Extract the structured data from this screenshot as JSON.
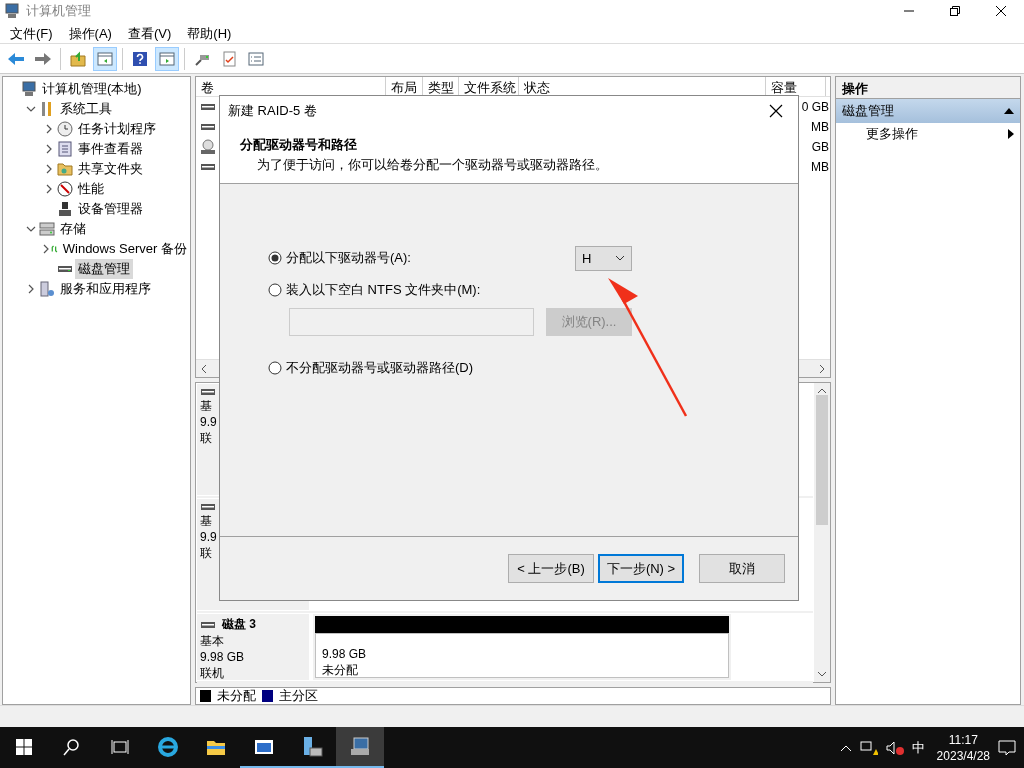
{
  "window": {
    "title": "计算机管理"
  },
  "menu": [
    "文件(F)",
    "操作(A)",
    "查看(V)",
    "帮助(H)"
  ],
  "toolbar": [
    {
      "kind": "back",
      "pressed": false
    },
    {
      "kind": "forward",
      "pressed": false
    },
    {
      "kind": "up",
      "pressed": false
    },
    {
      "kind": "tree-pane",
      "pressed": true
    },
    {
      "kind": "help",
      "pressed": false
    },
    {
      "kind": "action-pane",
      "pressed": true
    },
    {
      "kind": "connect",
      "pressed": false
    },
    {
      "kind": "check",
      "pressed": false
    },
    {
      "kind": "list",
      "pressed": false
    }
  ],
  "tree": [
    {
      "label": "计算机管理(本地)",
      "kind": "computer",
      "selected": false,
      "children": [
        {
          "label": "系统工具",
          "kind": "tools",
          "expanded": true,
          "selected": false,
          "children": [
            {
              "label": "任务计划程序",
              "kind": "clock",
              "expanded": false,
              "selected": false
            },
            {
              "label": "事件查看器",
              "kind": "log",
              "expanded": false,
              "selected": false
            },
            {
              "label": "共享文件夹",
              "kind": "share",
              "expanded": false,
              "selected": false
            },
            {
              "label": "性能",
              "kind": "gauge",
              "expanded": false,
              "selected": false
            },
            {
              "label": "设备管理器",
              "kind": "device",
              "selected": false
            }
          ]
        },
        {
          "label": "存储",
          "kind": "storage",
          "expanded": true,
          "selected": false,
          "children": [
            {
              "label": "Windows Server 备份",
              "kind": "backup",
              "expanded": false,
              "selected": false
            },
            {
              "label": "磁盘管理",
              "kind": "disk",
              "selected": true
            }
          ]
        },
        {
          "label": "服务和应用程序",
          "kind": "services",
          "expanded": false,
          "selected": false
        }
      ]
    }
  ],
  "volume_table": {
    "columns": [
      "卷",
      "布局",
      "类型",
      "文件系统",
      "状态",
      "容量"
    ],
    "rows": [
      {
        "kind": "disk",
        "capacity": "0 GB"
      },
      {
        "kind": "disk",
        "capacity": "MB"
      },
      {
        "kind": "cd",
        "capacity": "GB"
      },
      {
        "kind": "disk",
        "capacity": "MB"
      }
    ]
  },
  "disks": [
    {
      "type": "基",
      "size": "9.9",
      "status": "联"
    },
    {
      "type": "基",
      "size": "9.9",
      "status": "联"
    },
    {
      "name": "磁盘 3",
      "type": "基本",
      "size": "9.98 GB",
      "status": "联机",
      "partition": {
        "size": "9.98 GB",
        "status": "未分配"
      }
    }
  ],
  "legend": [
    {
      "label": "未分配",
      "color": "#000000"
    },
    {
      "label": "主分区",
      "color": "#000080"
    }
  ],
  "actions": {
    "title": "操作",
    "sections": [
      {
        "label": "磁盘管理",
        "expanded": true,
        "items": [
          "更多操作"
        ]
      }
    ]
  },
  "dialog": {
    "title": "新建 RAID-5 卷",
    "heading": "分配驱动器号和路径",
    "description": "为了便于访问，你可以给卷分配一个驱动器号或驱动器路径。",
    "options": [
      {
        "kind": "drive",
        "label": "分配以下驱动器号(A):",
        "selected": true
      },
      {
        "kind": "folder",
        "label": "装入以下空白 NTFS 文件夹中(M):",
        "selected": false
      },
      {
        "kind": "none",
        "label": "不分配驱动器号或驱动器路径(D)",
        "selected": false
      }
    ],
    "drive_letter": "H",
    "browse": {
      "label": "浏览(R)...",
      "disabled": true
    },
    "buttons": [
      {
        "label": "< 上一步(B)",
        "focused": false
      },
      {
        "label": "下一步(N) >",
        "focused": true
      },
      {
        "label": "取消",
        "focused": false
      }
    ]
  },
  "taskbar": {
    "apps": [
      {
        "kind": "ie",
        "open": false,
        "active": false
      },
      {
        "kind": "explorer",
        "open": false,
        "active": false
      },
      {
        "kind": "window",
        "open": true,
        "active": false
      },
      {
        "kind": "server",
        "open": true,
        "active": false
      },
      {
        "kind": "compmgmt",
        "open": true,
        "active": true
      }
    ],
    "ime": "中",
    "time": "11:17",
    "date": "2023/4/28"
  }
}
